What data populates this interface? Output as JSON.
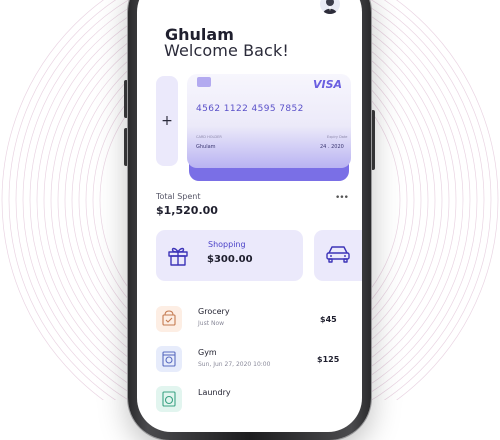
{
  "header": {
    "user_name": "Ghulam",
    "welcome_text": "Welcome Back!"
  },
  "card": {
    "brand": "VISA",
    "number": "4562 1122 4595 7852",
    "holder_label": "CARD HOLDER",
    "expiry_label": "Expiry Date",
    "holder": "Ghulam",
    "expiry": "24 . 2020",
    "add_symbol": "+"
  },
  "summary": {
    "label": "Total Spent",
    "amount": "$1,520.00",
    "more": "•••"
  },
  "categories": [
    {
      "name": "Shopping",
      "amount": "$300.00",
      "icon": "gift-icon"
    },
    {
      "name": "",
      "amount": "",
      "icon": "car-icon"
    }
  ],
  "transactions": [
    {
      "title": "Grocery",
      "subtitle": "Just Now",
      "amount": "$45",
      "icon": "grocery-bag-icon",
      "color": "#fdeee4"
    },
    {
      "title": "Gym",
      "subtitle": "Sun, Jun 27, 2020 10:00",
      "amount": "$125",
      "icon": "gym-machine-icon",
      "color": "#e7ecfb"
    },
    {
      "title": "Laundry",
      "subtitle": "",
      "amount": "",
      "icon": "laundry-icon",
      "color": "#e2f5ef"
    }
  ],
  "colors": {
    "accent": "#6a5ee0",
    "tile_bg": "#ebe9fb",
    "text_dark": "#1f1f2e"
  }
}
